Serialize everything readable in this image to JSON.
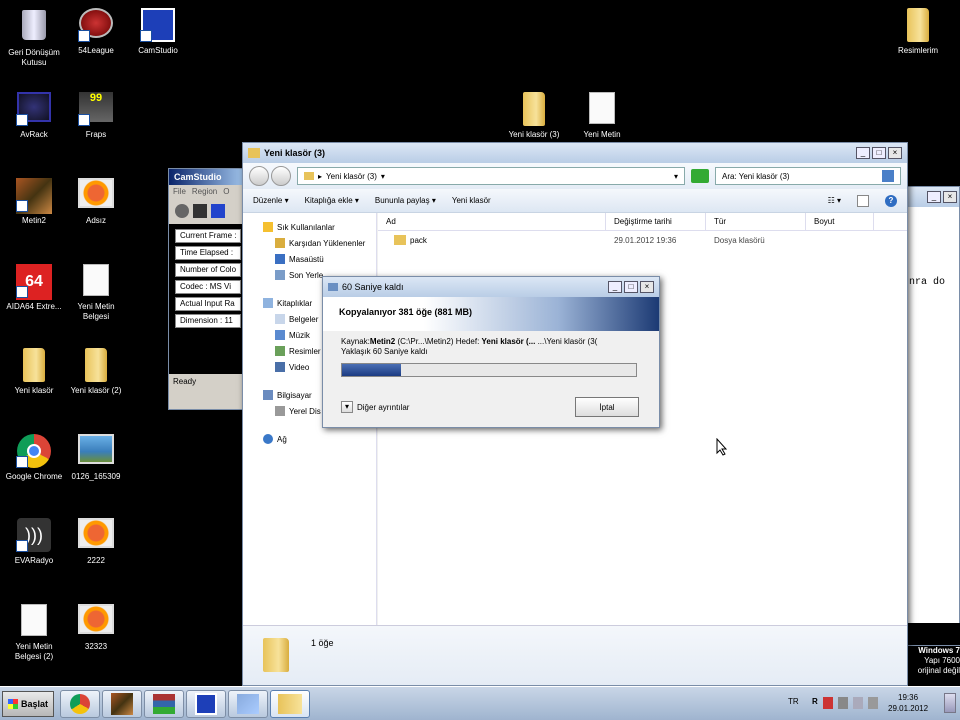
{
  "desktop": {
    "icons": [
      {
        "label": "Geri Dönüşüm Kutusu",
        "icon": "recycle-bin-icon"
      },
      {
        "label": "54League",
        "icon": "game-icon"
      },
      {
        "label": "CamStudio",
        "icon": "camstudio-icon"
      },
      {
        "label": "AvRack",
        "icon": "avrack-icon"
      },
      {
        "label": "Fraps",
        "icon": "fraps-icon"
      },
      {
        "label": "Metin2",
        "icon": "metin2-icon"
      },
      {
        "label": "Adsız",
        "icon": "image-icon"
      },
      {
        "label": "AIDA64 Extre...",
        "icon": "aida64-icon"
      },
      {
        "label": "Yeni Metin Belgesi",
        "icon": "text-document-icon"
      },
      {
        "label": "Yeni klasör",
        "icon": "folder-icon"
      },
      {
        "label": "Yeni klasör (2)",
        "icon": "folder-icon"
      },
      {
        "label": "Google Chrome",
        "icon": "chrome-icon"
      },
      {
        "label": "0126_165309",
        "icon": "image-icon"
      },
      {
        "label": "EVARadyo",
        "icon": "radio-icon"
      },
      {
        "label": "2222",
        "icon": "image-icon"
      },
      {
        "label": "Yeni Metin Belgesi (2)",
        "icon": "text-document-icon"
      },
      {
        "label": "32323",
        "icon": "image-icon"
      },
      {
        "label": "Resimlerim",
        "icon": "folder-icon"
      },
      {
        "label": "Yeni klasör (3)",
        "icon": "folder-icon"
      },
      {
        "label": "Yeni Metin",
        "icon": "text-document-icon"
      }
    ]
  },
  "camstudio": {
    "title": "CamStudio",
    "menu": [
      "File",
      "Region",
      "O"
    ],
    "fields": [
      "Current Frame :",
      "Time Elapsed :",
      "Number of Colo",
      "Codec : MS Vi",
      "Actual Input Ra",
      "Dimension : 11"
    ],
    "status": "Ready"
  },
  "explorer": {
    "title": "Yeni klasör (3)",
    "address": "Yeni klasör (3)",
    "search_placeholder": "Ara: Yeni klasör (3)",
    "commands": [
      "Düzenle",
      "Kitaplığa ekle",
      "Bununla paylaş",
      "Yeni klasör"
    ],
    "nav": {
      "favorites": "Sık Kullanılanlar",
      "downloads": "Karşıdan Yüklenenler",
      "desktop": "Masaüstü",
      "recent": "Son Yerle",
      "libraries": "Kitaplıklar",
      "documents": "Belgeler",
      "music": "Müzik",
      "pictures": "Resimler",
      "video": "Video",
      "computer": "Bilgisayar",
      "local_disk": "Yerel Dis",
      "network": "Ağ"
    },
    "columns": [
      "Ad",
      "Değiştirme tarihi",
      "Tür",
      "Boyut"
    ],
    "files": [
      {
        "name": "pack",
        "date": "29.01.2012 19:36",
        "type": "Dosya klasörü",
        "size": ""
      }
    ],
    "details": "1 öğe"
  },
  "copy_dialog": {
    "title": "60 Saniye kaldı",
    "heading": "Kopyalanıyor 381 öğe (881 MB)",
    "source_prefix": "Kaynak:",
    "source_name": "Metin2",
    "source_path": "(C:\\Pr...\\Metin2) Hedef:",
    "dest_name": "Yeni klasör (...",
    "dest_path": "...\\Yeni klasör (3(",
    "remaining": "Yaklaşık 60 Saniye kaldı",
    "progress": 0.2,
    "more_details": "Diğer ayrıntılar",
    "cancel": "İptal"
  },
  "background_window": {
    "text": "nra do",
    "watermark_title": "Windows 7",
    "watermark_line2": "Yapı 7600",
    "watermark_line3": "orijinal değil"
  },
  "taskbar": {
    "start_label": "Başlat",
    "lang": "TR",
    "time": "19:36",
    "date": "29.01.2012"
  }
}
